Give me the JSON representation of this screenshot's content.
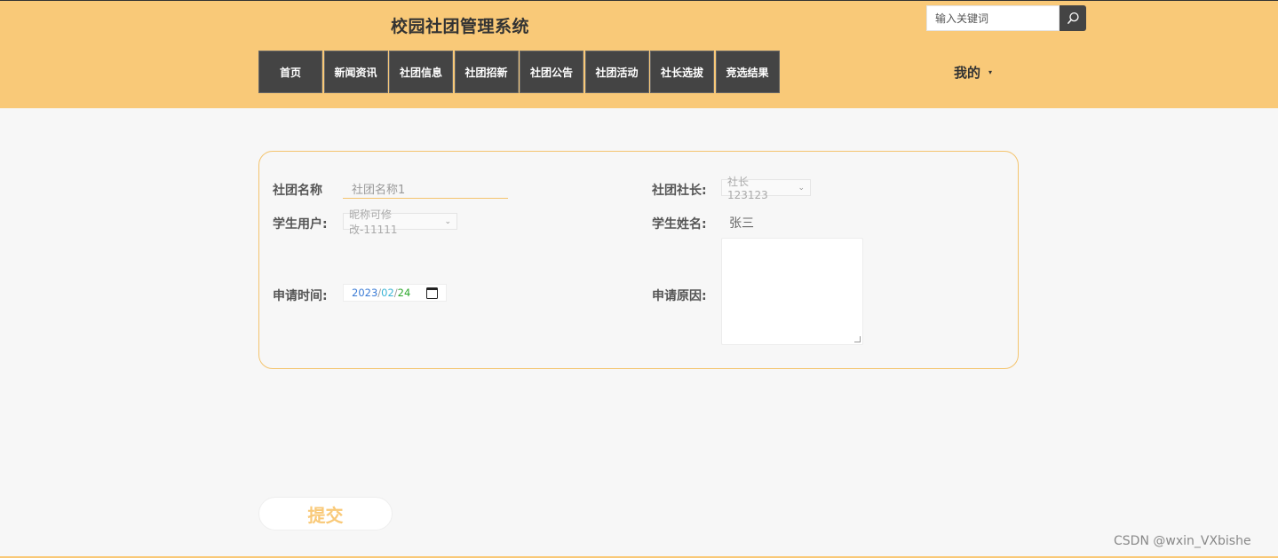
{
  "header": {
    "site_title": "校园社团管理系统",
    "search_placeholder": "输入关键词",
    "nav": [
      "首页",
      "新闻资讯",
      "社团信息",
      "社团招新",
      "社团公告",
      "社团活动",
      "社长选拔",
      "竞选结果"
    ],
    "mine_label": "我的",
    "mine_caret": "▾"
  },
  "form": {
    "club_name_label": "社团名称",
    "club_name_value": "社团名称1",
    "club_leader_label": "社团社长:",
    "club_leader_value": "社长 123123",
    "student_user_label": "学生用户:",
    "student_user_value": "昵称可修改-11111",
    "student_name_label": "学生姓名:",
    "student_name_value": "张三",
    "apply_time_label": "申请时间:",
    "apply_time_value": {
      "year": "2023",
      "month": "02",
      "day": "24"
    },
    "apply_reason_label": "申请原因:",
    "apply_reason_value": ""
  },
  "submit_label": "提交",
  "watermark": "CSDN @wxin_VXbishe",
  "colors": {
    "accent": "#f9c978",
    "nav_bg": "#444444",
    "page_bg": "#f7f7f7"
  }
}
